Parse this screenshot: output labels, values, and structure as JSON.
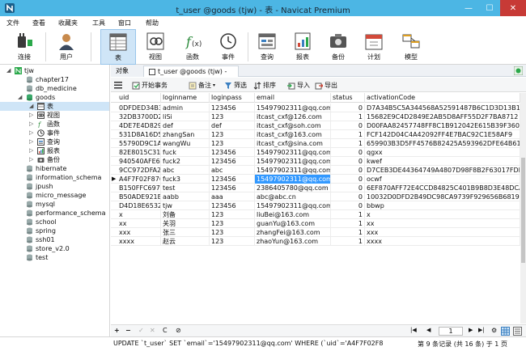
{
  "window": {
    "title": "t_user @goods (tjw) - 表 - Navicat Premium",
    "min": "—",
    "max": "☐",
    "close": "✕"
  },
  "menu": [
    "文件",
    "查看",
    "收藏夹",
    "工具",
    "窗口",
    "帮助"
  ],
  "toolbar": {
    "connect": "连接",
    "user": "用户",
    "table": "表",
    "view": "视图",
    "function": "函数",
    "event": "事件",
    "query": "查询",
    "report": "报表",
    "backup": "备份",
    "schedule": "计划",
    "model": "模型"
  },
  "nav": {
    "connection": "tjw",
    "databases_before": [
      "chapter17",
      "db_medicine"
    ],
    "open_db": "goods",
    "open_db_children": [
      "表",
      "视图",
      "函数",
      "事件",
      "查询",
      "报表",
      "备份"
    ],
    "databases_after": [
      "hibernate",
      "information_schema",
      "jpush",
      "micro_message",
      "mysql",
      "performance_schema",
      "school",
      "spring",
      "ssh01",
      "store_v2.0",
      "test"
    ]
  },
  "tabs": {
    "objects": "对象",
    "active": "t_user @goods (tjw) - 表"
  },
  "subtoolbar": {
    "begin_tx": "开始事务",
    "memo": "备注",
    "filter": "筛选",
    "sort": "排序",
    "import": "导入",
    "export": "导出"
  },
  "grid": {
    "columns": [
      "uid",
      "loginname",
      "loginpass",
      "email",
      "status",
      "activationCode"
    ],
    "rows": [
      [
        "0DFDED34B34",
        "admin",
        "123456",
        "15497902311@qq.com",
        "0",
        "D7A34B5C5A344568A52591487B6C1D3D13B1"
      ],
      [
        "32DB3700D25",
        "liSi",
        "123",
        "itcast_cxf@126.com",
        "1",
        "15682E9C4D2849E2AB5D8AFF55D2F7BA8712"
      ],
      [
        "4DE7E4D829A",
        "def",
        "def",
        "itcast_cxf@soh.com",
        "0",
        "D00FAA82457748FF8C1B912042E615B39F360"
      ],
      [
        "531D8A16D52",
        "zhangSan",
        "123",
        "itcast_cxf@163.com",
        "1",
        "FCF142D04C4A42092FF4E7BAC92C1E58AF9"
      ],
      [
        "55790D9C1A1",
        "wangWu",
        "123",
        "itcast_cxf@sina.com",
        "1",
        "659903B3D5FF4576B82425A593962DFE64B61"
      ],
      [
        "82E8015C315",
        "fuck",
        "123456",
        "15497902311@qq.com",
        "0",
        "qgxx"
      ],
      [
        "940540AFE6A",
        "fuck2",
        "123456",
        "15497902311@qq.com",
        "0",
        "kwef"
      ],
      [
        "9CC972DFA2D",
        "abc",
        "abc",
        "15497902311@qq.com",
        "0",
        "D7CEB3DE44364749A4807D98F8B2F63017FDF"
      ],
      [
        "A4F7F02F8764",
        "fuck3",
        "123456",
        "15497902311@qq.com",
        "0",
        "ocwf"
      ],
      [
        "B150FFC6979",
        "test",
        "123456",
        "2386405780@qq.com",
        "0",
        "6EF870AFF72E4CCD84825C401B9B8D3E48DCA"
      ],
      [
        "B50ADE921BF",
        "aabb",
        "aaa",
        "abc@abc.cn",
        "0",
        "10032D0DFD2B49DC98CA9739F929656B6819B"
      ],
      [
        "D4D18E65320",
        "tjw",
        "123456",
        "15497902311@qq.com",
        "0",
        "bbwp"
      ],
      [
        "x",
        "刘备",
        "123",
        "liuBei@163.com",
        "1",
        "x"
      ],
      [
        "xx",
        "关羽",
        "123",
        "guanYu@163.com",
        "1",
        "xx"
      ],
      [
        "xxx",
        "张三",
        "123",
        "zhangFei@163.com",
        "1",
        "xxx"
      ],
      [
        "xxxx",
        "赵云",
        "123",
        "zhaoYun@163.com",
        "1",
        "xxxx"
      ]
    ],
    "current_row_index": 8,
    "highlighted_column": 3
  },
  "bottombar": {
    "add": "+",
    "remove": "−",
    "apply": "✓",
    "discard": "✕",
    "refresh": "C",
    "stop": "⊘",
    "first": "|◀",
    "prev": "◀",
    "page": "1",
    "next": "▶",
    "last": "▶|",
    "settings": "⚙"
  },
  "status": {
    "sql": "UPDATE `t_user` SET `email`='15497902311@qq.com' WHERE (`uid`='A4F7F02F8",
    "count": "第 9 条记录 (共 16 条) 于 1 页"
  },
  "colors": {
    "titlebar": "#4cb6e4",
    "close": "#c73a36",
    "selection": "#3399ff",
    "nav_selected": "#cfe5f7"
  }
}
